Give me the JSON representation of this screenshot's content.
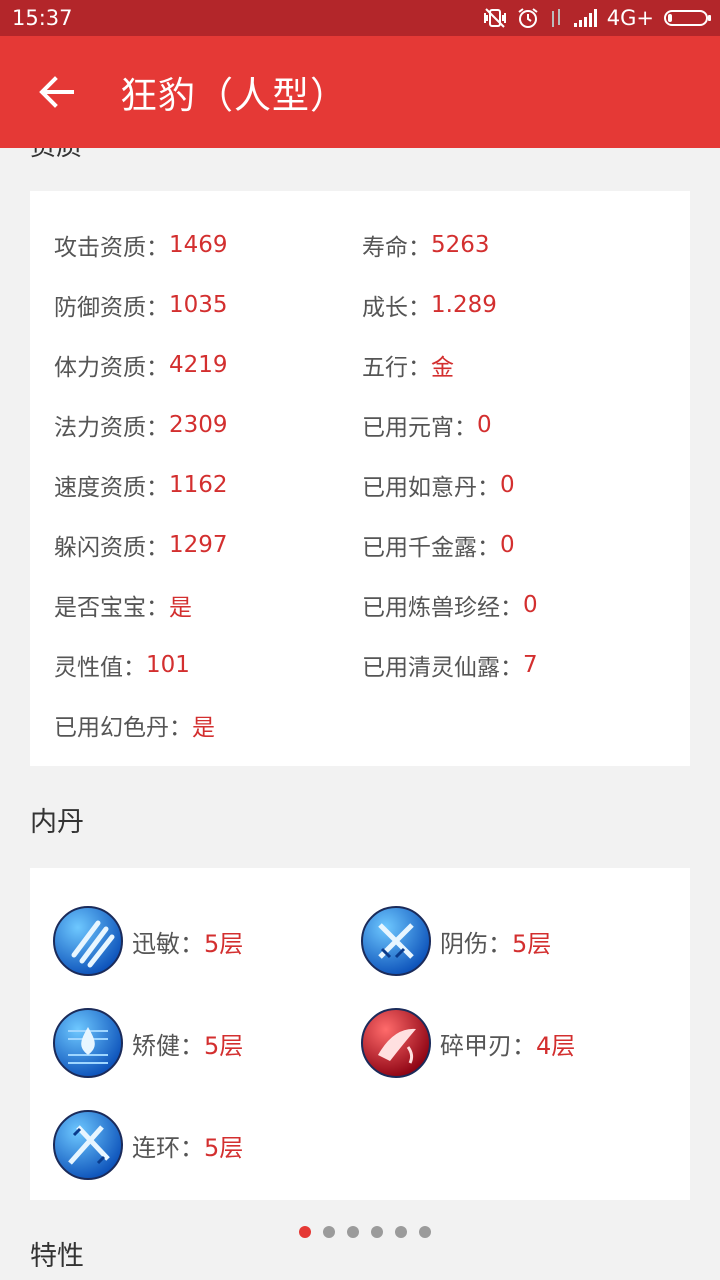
{
  "status_bar": {
    "time": "15:37",
    "network": "4G+",
    "battery_level": 0.1,
    "icons": [
      "vibrate-off-icon",
      "alarm-icon",
      "signal-icon"
    ]
  },
  "app_bar": {
    "title": "狂豹（人型）",
    "back_icon": "arrow-left-icon"
  },
  "qualification": {
    "header_cut": "资质",
    "left": [
      {
        "label": "攻击资质：",
        "value": "1469"
      },
      {
        "label": "防御资质：",
        "value": "1035"
      },
      {
        "label": "体力资质：",
        "value": "4219"
      },
      {
        "label": "法力资质：",
        "value": "2309"
      },
      {
        "label": "速度资质：",
        "value": "1162"
      },
      {
        "label": "躲闪资质：",
        "value": "1297"
      },
      {
        "label": "是否宝宝：",
        "value": "是"
      },
      {
        "label": "灵性值：",
        "value": "101"
      },
      {
        "label": "已用幻色丹：",
        "value": "是"
      }
    ],
    "right": [
      {
        "label": "寿命：",
        "value": "5263"
      },
      {
        "label": "成长：",
        "value": "1.289"
      },
      {
        "label": "五行：",
        "value": "金"
      },
      {
        "label": "已用元宵：",
        "value": "0"
      },
      {
        "label": "已用如意丹：",
        "value": "0"
      },
      {
        "label": "已用千金露：",
        "value": "0"
      },
      {
        "label": "已用炼兽珍经：",
        "value": "0"
      },
      {
        "label": "已用清灵仙露：",
        "value": "7"
      }
    ]
  },
  "neidan": {
    "title": "内丹",
    "items": [
      {
        "name": "迅敏：",
        "level": "5层",
        "icon": "claw-slash-icon",
        "color": "blue"
      },
      {
        "name": "阴伤：",
        "level": "5层",
        "icon": "crossed-swords-icon",
        "color": "blue"
      },
      {
        "name": "矫健：",
        "level": "5层",
        "icon": "water-drop-icon",
        "color": "blue"
      },
      {
        "name": "碎甲刃：",
        "level": "4层",
        "icon": "blood-blade-icon",
        "color": "red"
      },
      {
        "name": "连环：",
        "level": "5层",
        "icon": "chain-swords-icon",
        "color": "blue"
      }
    ]
  },
  "traits": {
    "title": "特性"
  },
  "pager": {
    "count": 6,
    "active": 0
  },
  "colors": {
    "status_bar": "#b3262a",
    "app_bar": "#e53936",
    "value_text": "#d32f2f",
    "label_text": "#555555",
    "background": "#f2f2f2"
  }
}
